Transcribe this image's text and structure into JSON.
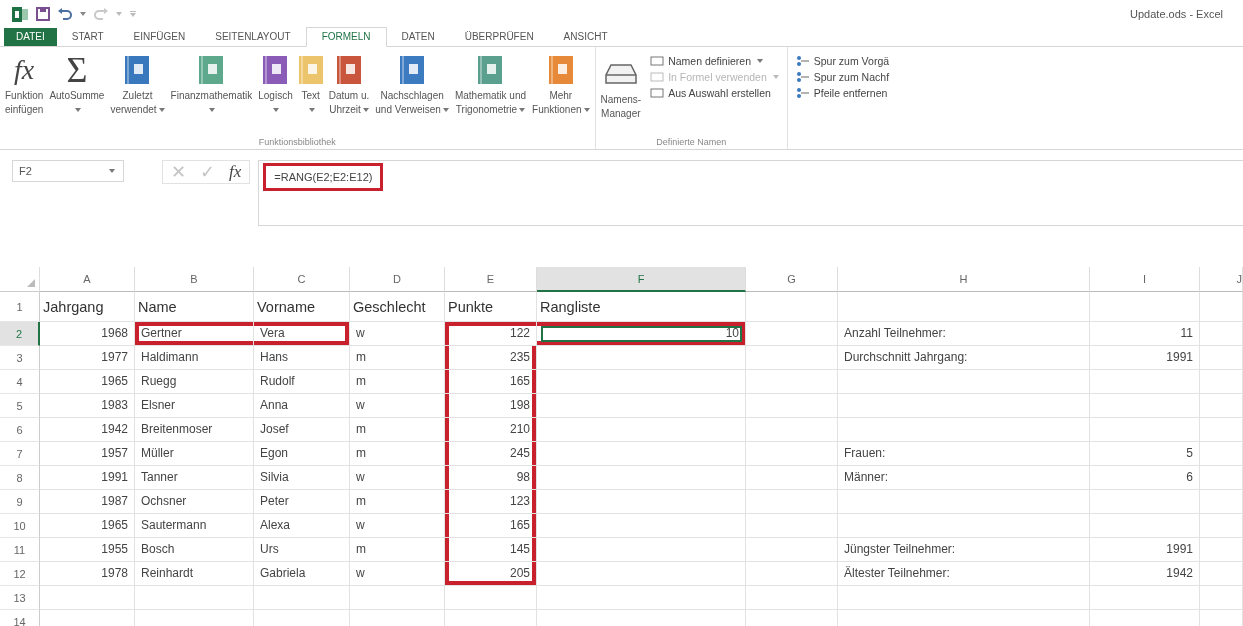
{
  "window": {
    "title": "Update.ods - Excel"
  },
  "tabs": [
    {
      "label": "DATEI",
      "kind": "file",
      "selected": false
    },
    {
      "label": "START",
      "kind": "tab",
      "selected": false
    },
    {
      "label": "EINFÜGEN",
      "kind": "tab",
      "selected": false
    },
    {
      "label": "SEITENLAYOUT",
      "kind": "tab",
      "selected": false
    },
    {
      "label": "FORMELN",
      "kind": "tab",
      "selected": true
    },
    {
      "label": "DATEN",
      "kind": "tab",
      "selected": false
    },
    {
      "label": "ÜBERPRÜFEN",
      "kind": "tab",
      "selected": false
    },
    {
      "label": "ANSICHT",
      "kind": "tab",
      "selected": false
    }
  ],
  "ribbon": {
    "function_library": {
      "label": "Funktionsbibliothek",
      "buttons": [
        {
          "glyph": "fx",
          "kind": "glyph",
          "lines": [
            "Funktion",
            "einfügen"
          ],
          "dropdown": false
        },
        {
          "glyph": "Σ",
          "kind": "glyph",
          "lines": [
            "AutoSumme"
          ],
          "dropdown": true
        },
        {
          "kind": "book",
          "color": "#3a78be",
          "lines": [
            "Zuletzt",
            "verwendet"
          ],
          "dropdown": true
        },
        {
          "kind": "book",
          "color": "#5ea88c",
          "lines": [
            "Finanzmathematik"
          ],
          "dropdown": true
        },
        {
          "kind": "book",
          "color": "#8a5cb8",
          "lines": [
            "Logisch"
          ],
          "dropdown": true
        },
        {
          "kind": "book",
          "color": "#ecc46c",
          "lines": [
            "Text"
          ],
          "dropdown": true
        },
        {
          "kind": "book",
          "color": "#c9553c",
          "lines": [
            "Datum u.",
            "Uhrzeit"
          ],
          "dropdown": true
        },
        {
          "kind": "book",
          "color": "#3d7bc0",
          "lines": [
            "Nachschlagen",
            "und Verweisen"
          ],
          "dropdown": true
        },
        {
          "kind": "book",
          "color": "#5b9f8e",
          "lines": [
            "Mathematik und",
            "Trigonometrie"
          ],
          "dropdown": true
        },
        {
          "kind": "book",
          "color": "#e68a3a",
          "lines": [
            "Mehr",
            "Funktionen"
          ],
          "dropdown": true
        }
      ]
    },
    "defined_names": {
      "label": "Definierte Namen",
      "manager": {
        "lines": [
          "Namens-",
          "Manager"
        ]
      },
      "items": [
        {
          "label": "Namen definieren",
          "dropdown": true,
          "disabled": false
        },
        {
          "label": "In Formel verwenden",
          "dropdown": true,
          "disabled": true
        },
        {
          "label": "Aus Auswahl erstellen",
          "dropdown": false,
          "disabled": false
        }
      ]
    },
    "auditing": {
      "items": [
        {
          "label": "Spur zum Vorgä"
        },
        {
          "label": "Spur zum Nachf"
        },
        {
          "label": "Pfeile entfernen"
        }
      ]
    }
  },
  "formula_bar": {
    "name_box": "F2",
    "cancel": "✕",
    "enter": "✓",
    "fx": "fx",
    "formula": "=RANG(E2;E2:E12)",
    "highlighted": true
  },
  "sheet": {
    "columns": [
      {
        "label": "A",
        "selected": false
      },
      {
        "label": "B",
        "selected": false
      },
      {
        "label": "C",
        "selected": false
      },
      {
        "label": "D",
        "selected": false
      },
      {
        "label": "E",
        "selected": false
      },
      {
        "label": "F",
        "selected": true
      },
      {
        "label": "G",
        "selected": false
      },
      {
        "label": "H",
        "selected": false
      },
      {
        "label": "I",
        "selected": false
      },
      {
        "label": "J",
        "selected": false
      }
    ],
    "rows": [
      {
        "header": "1",
        "kind": "heading",
        "selected": false,
        "cells": [
          {
            "text": "Jahrgang",
            "framed": false
          },
          {
            "text": "Name",
            "framed": false
          },
          {
            "text": "Vorname",
            "framed": false
          },
          {
            "text": "Geschlecht",
            "framed": false
          },
          {
            "text": "Punkte",
            "framed": false
          },
          {
            "text": "Rangliste",
            "framed": false
          }
        ]
      },
      {
        "header": "2",
        "kind": "data",
        "selected": true,
        "cells": [
          {
            "text": "1968",
            "framed": false
          },
          {
            "text": "Gertner",
            "framed": true
          },
          {
            "text": "Vera",
            "framed": true
          },
          {
            "text": "w",
            "framed": false
          },
          {
            "text": "122",
            "framed": true
          },
          {
            "text": "10",
            "framed": true
          },
          null,
          {
            "text": "Anzahl Teilnehmer:",
            "framed": false
          },
          {
            "text": "11",
            "framed": false
          }
        ]
      },
      {
        "header": "3",
        "kind": "data",
        "selected": false,
        "cells": [
          {
            "text": "1977",
            "framed": false
          },
          {
            "text": "Haldimann",
            "framed": false
          },
          {
            "text": "Hans",
            "framed": false
          },
          {
            "text": "m",
            "framed": false
          },
          {
            "text": "235",
            "framed": true
          },
          null,
          null,
          {
            "text": "Durchschnitt Jahrgang:",
            "framed": false
          },
          {
            "text": "1991",
            "framed": false
          }
        ]
      },
      {
        "header": "4",
        "kind": "data",
        "selected": false,
        "cells": [
          {
            "text": "1965",
            "framed": false
          },
          {
            "text": "Ruegg",
            "framed": false
          },
          {
            "text": "Rudolf",
            "framed": false
          },
          {
            "text": "m",
            "framed": false
          },
          {
            "text": "165",
            "framed": true
          }
        ]
      },
      {
        "header": "5",
        "kind": "data",
        "selected": false,
        "cells": [
          {
            "text": "1983",
            "framed": false
          },
          {
            "text": "Elsner",
            "framed": false
          },
          {
            "text": "Anna",
            "framed": false
          },
          {
            "text": "w",
            "framed": false
          },
          {
            "text": "198",
            "framed": true
          }
        ]
      },
      {
        "header": "6",
        "kind": "data",
        "selected": false,
        "cells": [
          {
            "text": "1942",
            "framed": false
          },
          {
            "text": "Breitenmoser",
            "framed": false
          },
          {
            "text": "Josef",
            "framed": false
          },
          {
            "text": "m",
            "framed": false
          },
          {
            "text": "210",
            "framed": true
          }
        ]
      },
      {
        "header": "7",
        "kind": "data",
        "selected": false,
        "cells": [
          {
            "text": "1957",
            "framed": false
          },
          {
            "text": "Müller",
            "framed": false
          },
          {
            "text": "Egon",
            "framed": false
          },
          {
            "text": "m",
            "framed": false
          },
          {
            "text": "245",
            "framed": true
          },
          null,
          null,
          {
            "text": "Frauen:",
            "framed": false
          },
          {
            "text": "5",
            "framed": false
          }
        ]
      },
      {
        "header": "8",
        "kind": "data",
        "selected": false,
        "cells": [
          {
            "text": "1991",
            "framed": false
          },
          {
            "text": "Tanner",
            "framed": false
          },
          {
            "text": "Silvia",
            "framed": false
          },
          {
            "text": "w",
            "framed": false
          },
          {
            "text": "98",
            "framed": true
          },
          null,
          null,
          {
            "text": "Männer:",
            "framed": false
          },
          {
            "text": "6",
            "framed": false
          }
        ]
      },
      {
        "header": "9",
        "kind": "data",
        "selected": false,
        "cells": [
          {
            "text": "1987",
            "framed": false
          },
          {
            "text": "Ochsner",
            "framed": false
          },
          {
            "text": "Peter",
            "framed": false
          },
          {
            "text": "m",
            "framed": false
          },
          {
            "text": "123",
            "framed": true
          }
        ]
      },
      {
        "header": "10",
        "kind": "data",
        "selected": false,
        "cells": [
          {
            "text": "1965",
            "framed": false
          },
          {
            "text": "Sautermann",
            "framed": false
          },
          {
            "text": "Alexa",
            "framed": false
          },
          {
            "text": "w",
            "framed": false
          },
          {
            "text": "165",
            "framed": true
          }
        ]
      },
      {
        "header": "11",
        "kind": "data",
        "selected": false,
        "cells": [
          {
            "text": "1955",
            "framed": false
          },
          {
            "text": "Bosch",
            "framed": false
          },
          {
            "text": "Urs",
            "framed": false
          },
          {
            "text": "m",
            "framed": false
          },
          {
            "text": "145",
            "framed": true
          },
          null,
          null,
          {
            "text": "Jüngster Teilnehmer:",
            "framed": false
          },
          {
            "text": "1991",
            "framed": false
          }
        ]
      },
      {
        "header": "12",
        "kind": "data",
        "selected": false,
        "cells": [
          {
            "text": "1978",
            "framed": false
          },
          {
            "text": "Reinhardt",
            "framed": false
          },
          {
            "text": "Gabriela",
            "framed": false
          },
          {
            "text": "w",
            "framed": false
          },
          {
            "text": "205",
            "framed": true
          },
          null,
          null,
          {
            "text": "Ältester Teilnehmer:",
            "framed": false
          },
          {
            "text": "1942",
            "framed": false
          }
        ]
      },
      {
        "header": "13",
        "kind": "data",
        "selected": false,
        "cells": []
      },
      {
        "header": "14",
        "kind": "data",
        "selected": false,
        "cells": []
      }
    ]
  }
}
